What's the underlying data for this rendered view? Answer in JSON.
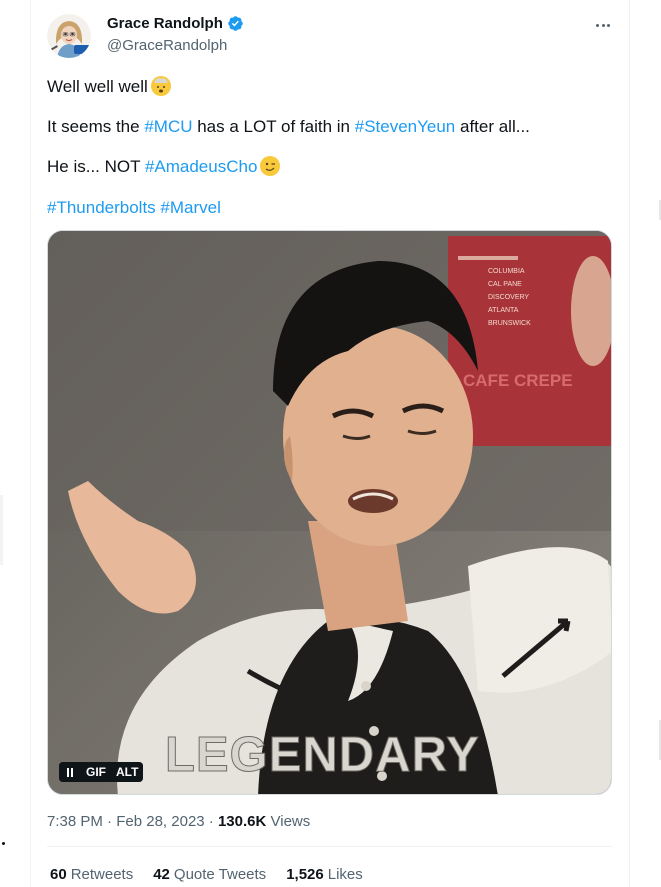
{
  "author": {
    "display_name": "Grace Randolph",
    "handle": "@GraceRandolph",
    "verified": true,
    "avatar_badge": "BEYOND THE TRAILER",
    "avatar_icon": "avatar-illustration"
  },
  "more_label": "More",
  "tweet": {
    "line1": {
      "text": "Well well well",
      "emoji": "exploding-head-emoji"
    },
    "line2": {
      "pre": "It seems the ",
      "tag1": "#MCU",
      "mid": " has a LOT of faith in ",
      "tag2": "#StevenYeun",
      "post": " after all..."
    },
    "line3": {
      "pre": "He is... NOT ",
      "tag": "#AmadeusCho",
      "emoji": "winking-face-emoji"
    },
    "line4": {
      "tag1": "#Thunderbolts",
      "tag2": "#Marvel"
    }
  },
  "media": {
    "caption": "LEGENDARY",
    "poster_lines": [
      "COLUMBIA",
      "CAL PANE",
      "DISCOVERY",
      "ATLANTA",
      "BRUNSWICK"
    ],
    "poster_big": "CAFE CREPE",
    "controls": {
      "gif": "GIF",
      "alt": "ALT"
    }
  },
  "meta": {
    "time": "7:38 PM",
    "sep1": " · ",
    "date": "Feb 28, 2023",
    "sep2": " · ",
    "views_count": "130.6K",
    "views_label": " Views"
  },
  "stats": {
    "retweets_count": "60",
    "retweets_label": "Retweets",
    "quotes_count": "42",
    "quotes_label": "Quote Tweets",
    "likes_count": "1,526",
    "likes_label": "Likes"
  },
  "colors": {
    "link": "#1d9bf0",
    "text": "#0f1419",
    "muted": "#536471"
  }
}
